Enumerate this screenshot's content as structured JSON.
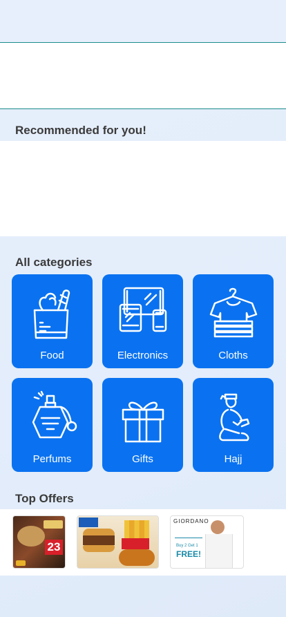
{
  "sections": {
    "recommended": "Recommended for you!",
    "categories": "All categories",
    "offers": "Top Offers"
  },
  "categories": [
    {
      "label": "Food",
      "icon": "grocery-bag-icon"
    },
    {
      "label": "Electronics",
      "icon": "devices-icon"
    },
    {
      "label": "Cloths",
      "icon": "clothes-icon"
    },
    {
      "label": "Perfums",
      "icon": "perfume-bottle-icon"
    },
    {
      "label": "Gifts",
      "icon": "gift-box-icon"
    },
    {
      "label": "Hajj",
      "icon": "praying-person-icon"
    }
  ],
  "offers": {
    "offer1": {
      "number": "23"
    },
    "offer3": {
      "brand": "GIORDANO",
      "promo": "Buy 2 Get 1",
      "free": "FREE!"
    }
  },
  "colors": {
    "accent": "#0a72f0",
    "background": "#e6effb",
    "divider": "#1a8c8c"
  }
}
